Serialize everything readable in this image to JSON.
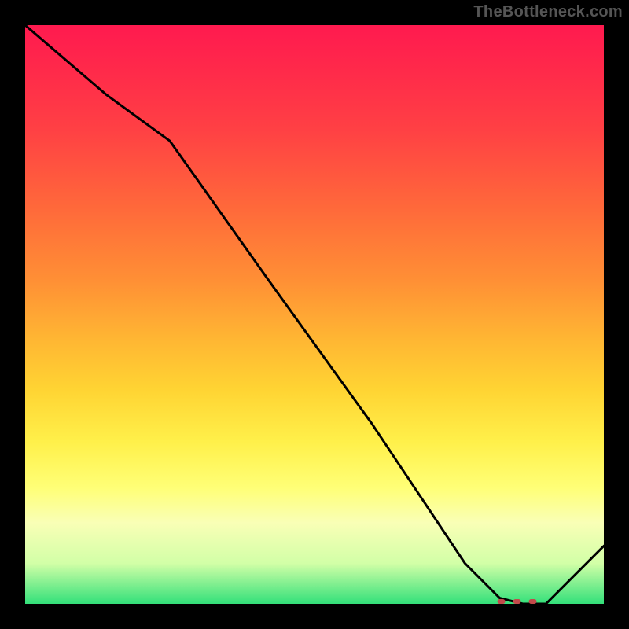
{
  "watermark": "TheBottleneck.com",
  "chart_data": {
    "type": "line",
    "title": "",
    "xlabel": "",
    "ylabel": "",
    "xlim": [
      0,
      100
    ],
    "ylim": [
      0,
      100
    ],
    "grid": false,
    "legend": false,
    "series": [
      {
        "name": "bottleneck-curve",
        "x": [
          0,
          14,
          25,
          42,
          60,
          76,
          82,
          86,
          90,
          100
        ],
        "y": [
          100,
          88,
          80,
          56,
          31,
          7,
          1,
          0,
          0,
          10
        ]
      }
    ],
    "markers": {
      "name": "optimal-range-dots",
      "color": "#c24a4a",
      "x_start": 82,
      "x_end": 90,
      "y": 0
    }
  }
}
